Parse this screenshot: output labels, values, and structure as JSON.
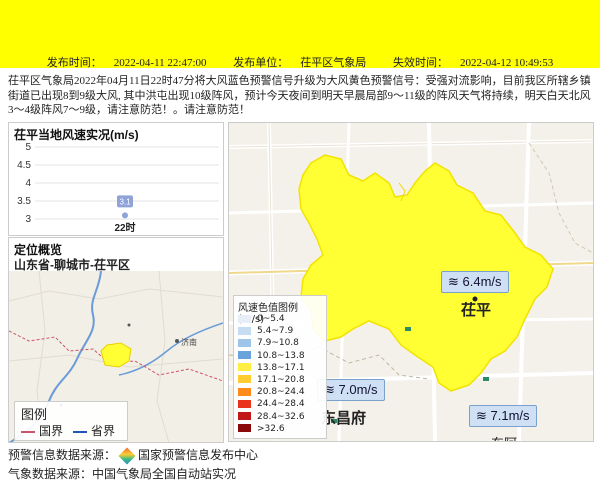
{
  "header": {
    "publish_time_label": "发布时间：",
    "publish_time": "2022-04-11 22:47:00",
    "publisher_label": "发布单位：",
    "publisher": "茌平区气象局",
    "expire_label": "失效时间：",
    "expire_time": "2022-04-12 10:49:53"
  },
  "description": "茌平区气象局2022年04月11日22时47分将大风蓝色预警信号升级为大风黄色预警信号：受强对流影响，目前我区所辖乡镇街道已出现8到9级大风, 其中洪屯出现10级阵风，预计今天夜间到明天早晨局部9～11级的阵风天气将持续，明天白天北风3～4级阵风7～9级，请注意防范！。请注意防范！",
  "wind_panel": {
    "title": "茌平当地风速实况(m/s)",
    "point_label": "3.1"
  },
  "chart_data": {
    "type": "scatter",
    "title": "茌平当地风速实况(m/s)",
    "categories": [
      "22时"
    ],
    "values": [
      3.1
    ],
    "yticks": [
      "5",
      "4.5",
      "4",
      "3.5",
      "3"
    ],
    "ylim": [
      3,
      5
    ],
    "xlabel": "",
    "ylabel": "",
    "color": "#8fa3d9"
  },
  "location_panel": {
    "title": "定位概览",
    "address": "山东省-聊城市-茌平区",
    "legend_title": "图例",
    "legend_country": "国界",
    "legend_province": "省界",
    "city_label": "济南"
  },
  "map_panel": {
    "legend_title": "风速色值图例 (m/s)",
    "legend_items": [
      {
        "label": "0~5.4",
        "color": "#e8eef8"
      },
      {
        "label": "5.4~7.9",
        "color": "#c6dcf2"
      },
      {
        "label": "7.9~10.8",
        "color": "#9ec4ea"
      },
      {
        "label": "10.8~13.8",
        "color": "#6aa3dc"
      },
      {
        "label": "13.8~17.1",
        "color": "#ffee44"
      },
      {
        "label": "17.1~20.8",
        "color": "#ffcc33"
      },
      {
        "label": "20.8~24.4",
        "color": "#ff8a1c"
      },
      {
        "label": "24.4~28.4",
        "color": "#e8341c"
      },
      {
        "label": "28.4~32.6",
        "color": "#c01818"
      },
      {
        "label": ">32.6",
        "color": "#8a0a0a"
      }
    ],
    "wind_labels": [
      {
        "text": "6.4m/s"
      },
      {
        "text": "7.0m/s"
      },
      {
        "text": "7.1m/s"
      }
    ],
    "place_chiping": "茌平",
    "place_dongchangfu": "东昌府",
    "place_partial": "东阿"
  },
  "footer": {
    "source_label": "预警信息数据来源：",
    "source_name": "国家预警信息发布中心",
    "weather_source": "气象数据来源：中国气象局全国自动站实况"
  },
  "colors": {
    "banner": "#ffff00",
    "warning_area": "#ffff33"
  }
}
